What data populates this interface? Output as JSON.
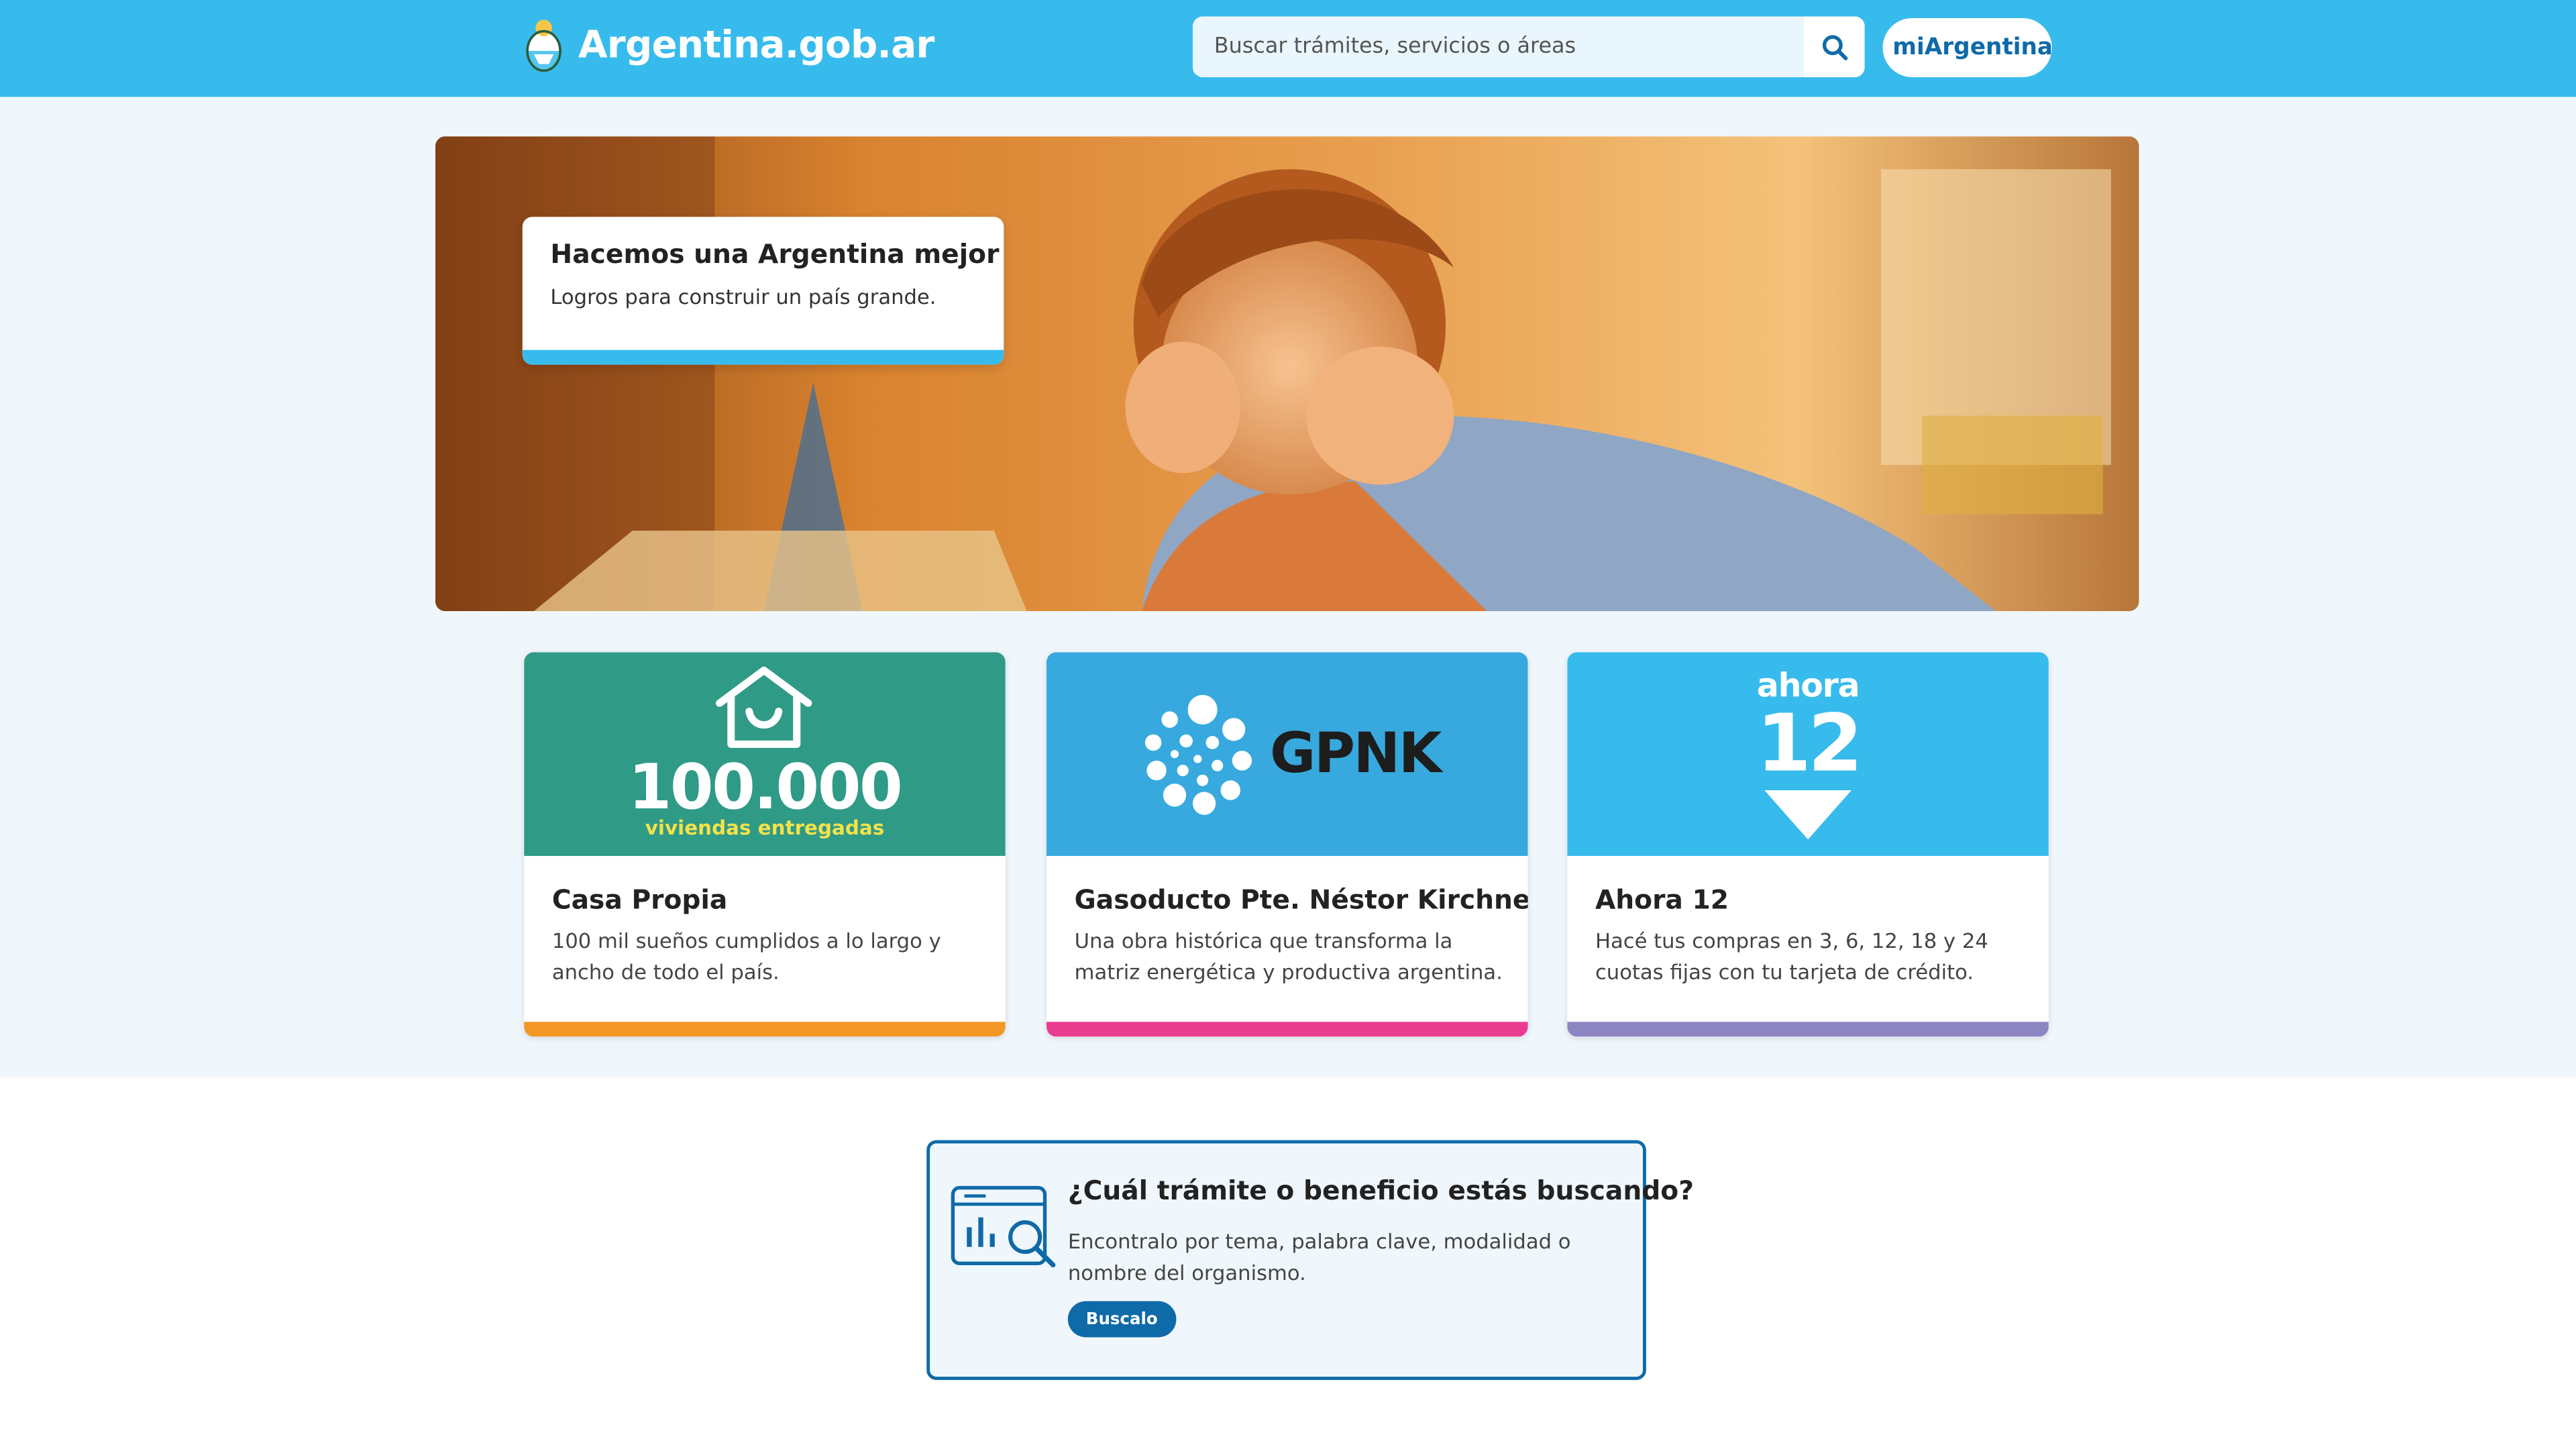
{
  "header": {
    "brand": "Argentina.gob.ar",
    "search_placeholder": "Buscar trámites, servicios o áreas",
    "mi_argentina_label": "miArgentina"
  },
  "hero": {
    "title": "Hacemos una Argentina mejor",
    "subtitle": "Logros para construir un país grande."
  },
  "cards": [
    {
      "image_number": "100.000",
      "image_caption": "viviendas entregadas",
      "title": "Casa Propia",
      "description": "100 mil sueños cumplidos a lo largo y ancho de todo el país.",
      "accent_color": "#f39625",
      "image_bg": "#2f9a86"
    },
    {
      "image_logo": "GPNK",
      "title": "Gasoducto Pte. Néstor Kirchner",
      "description": "Una obra histórica que transforma la matriz energética y productiva argentina.",
      "accent_color": "#e93c8e",
      "image_bg": "#37a9de"
    },
    {
      "image_top": "ahora",
      "image_number": "12",
      "title": "Ahora 12",
      "description": "Hacé tus compras en 3, 6, 12, 18 y 24 cuotas fijas con tu tarjeta de crédito.",
      "accent_color": "#8d86c2",
      "image_bg": "#37bbed"
    }
  ],
  "promo": {
    "title": "¿Cuál trámite o beneficio estás buscando?",
    "description": "Encontralo por tema, palabra clave, modalidad o nombre del organismo.",
    "button_label": "Buscalo"
  },
  "colors": {
    "header_bg": "#37bbed",
    "primary": "#0f6aa8",
    "light_bg": "#f0f7fc"
  }
}
